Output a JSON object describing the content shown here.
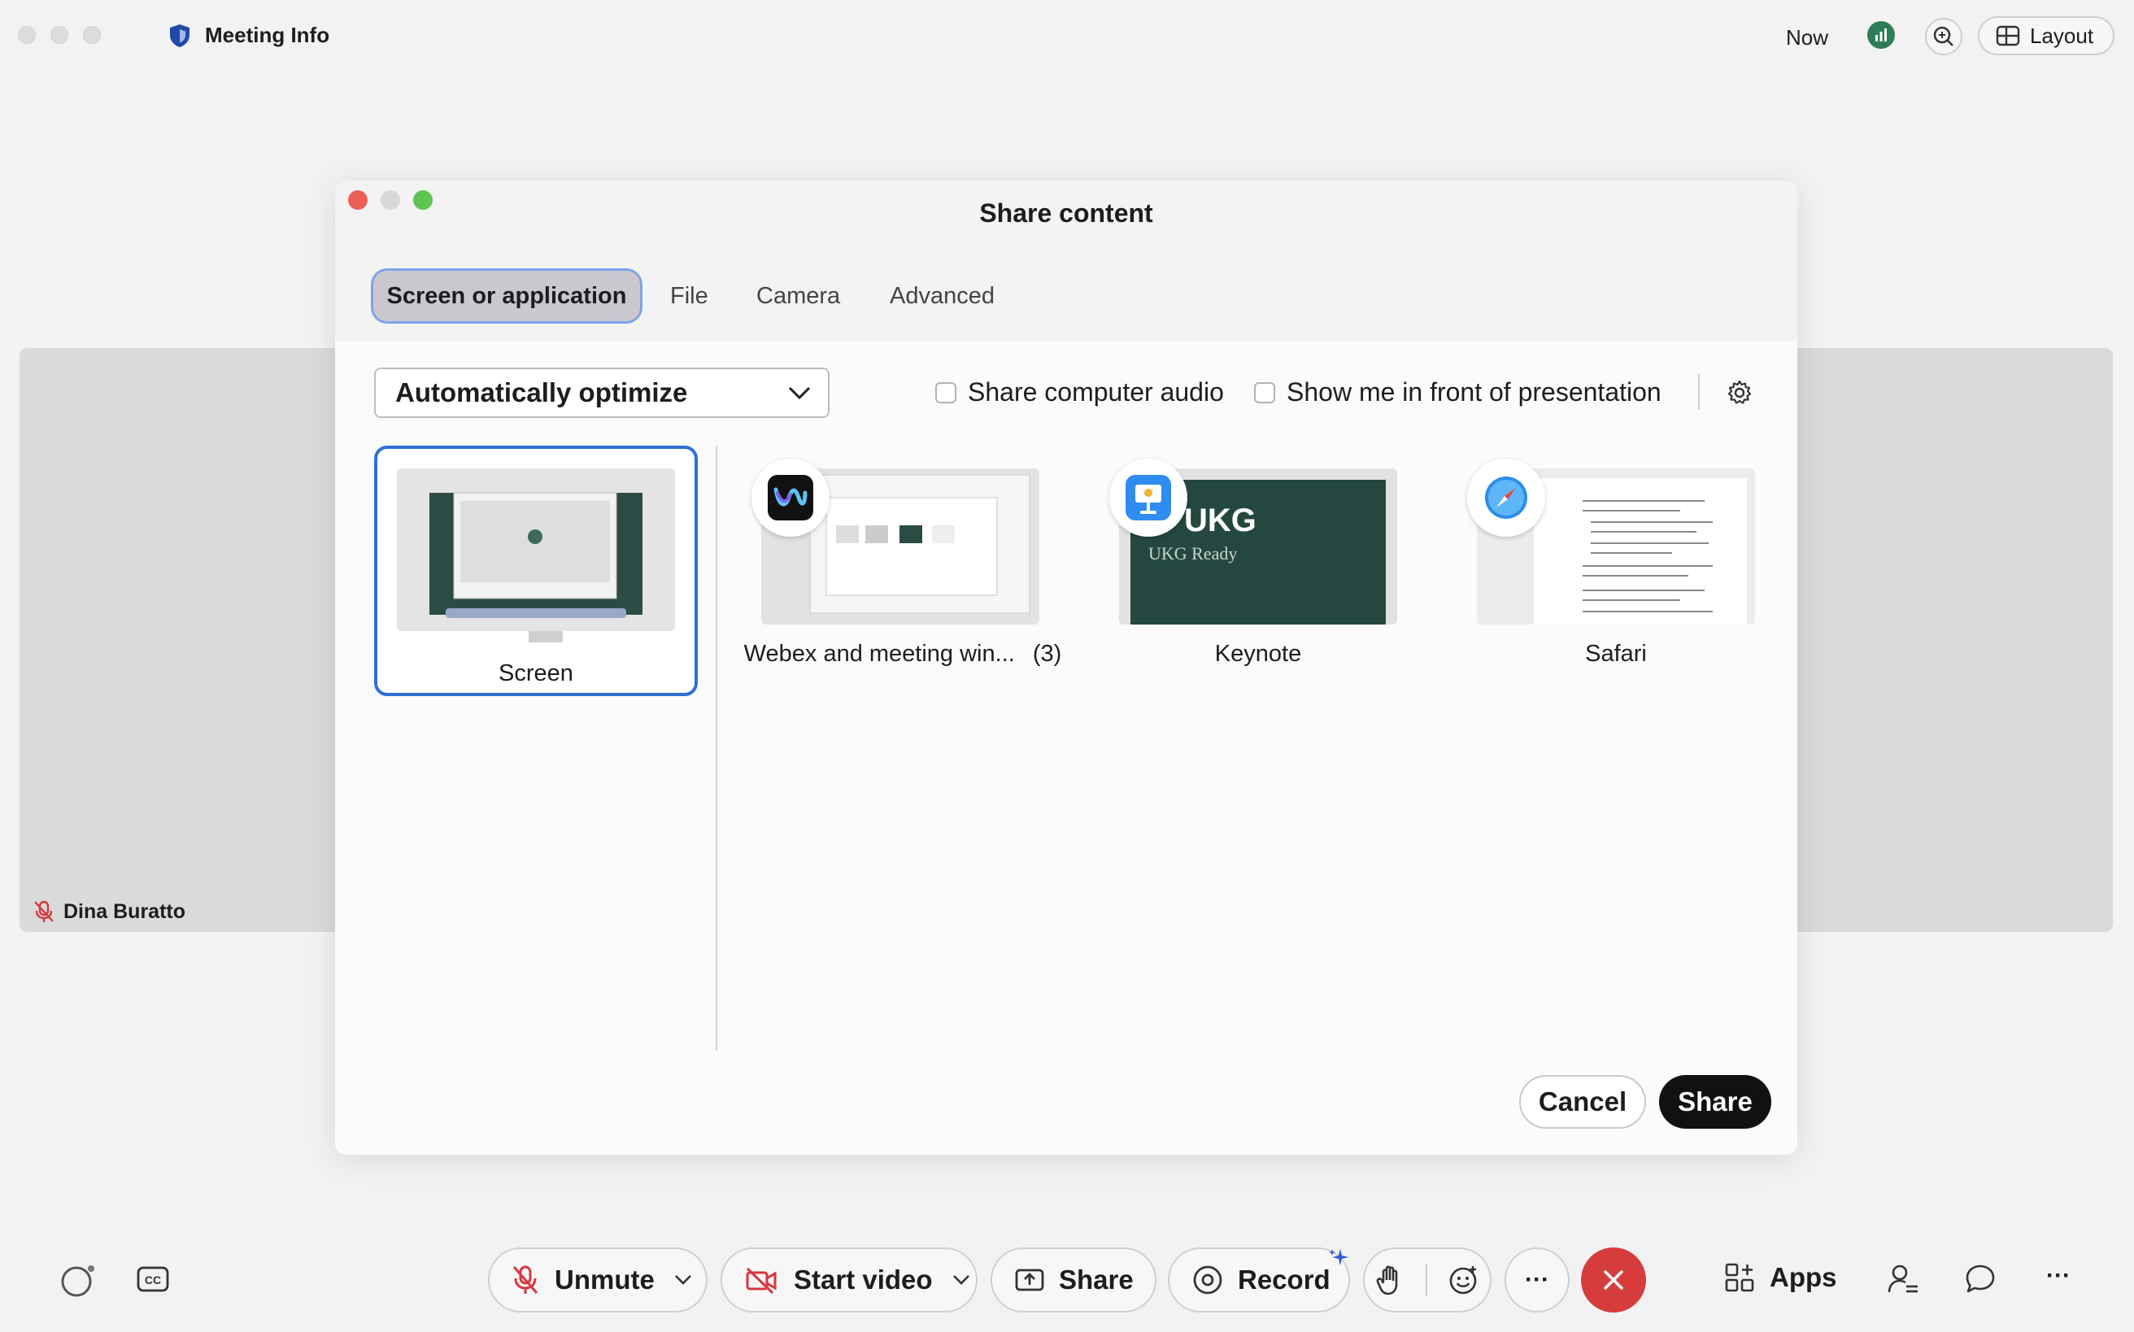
{
  "window": {
    "title": "Meeting Info",
    "time_label": "Now",
    "layout_label": "Layout"
  },
  "participant": {
    "name": "Dina Buratto"
  },
  "dialog": {
    "title": "Share content",
    "tabs": [
      "Screen or application",
      "File",
      "Camera",
      "Advanced"
    ],
    "active_tab": "Screen or application",
    "optimize_select": "Automatically optimize",
    "share_audio_label": "Share computer audio",
    "share_audio_checked": false,
    "show_me_label": "Show me in front of presentation",
    "show_me_checked": false,
    "sources": [
      {
        "label": "Screen",
        "icon": "monitor-icon",
        "selected": true
      },
      {
        "label": "Webex and meeting win...",
        "count": "(3)",
        "icon": "webex-app-icon"
      },
      {
        "label": "Keynote",
        "icon": "keynote-app-icon"
      },
      {
        "label": "Safari",
        "icon": "safari-app-icon"
      }
    ],
    "keynote_preview_title": "UKG",
    "keynote_preview_subtitle": "UKG Ready",
    "cancel_label": "Cancel",
    "share_label": "Share"
  },
  "toolbar": {
    "unmute_label": "Unmute",
    "start_video_label": "Start video",
    "share_label": "Share",
    "record_label": "Record",
    "more_label": "···",
    "apps_label": "Apps",
    "overflow_label": "···"
  },
  "colors": {
    "selected_border": "#2f6fd6",
    "end_call": "#d63c3c",
    "mute_red": "#d9363e",
    "signal_green": "#2e7d57",
    "keynote_bg": "#24483f"
  }
}
